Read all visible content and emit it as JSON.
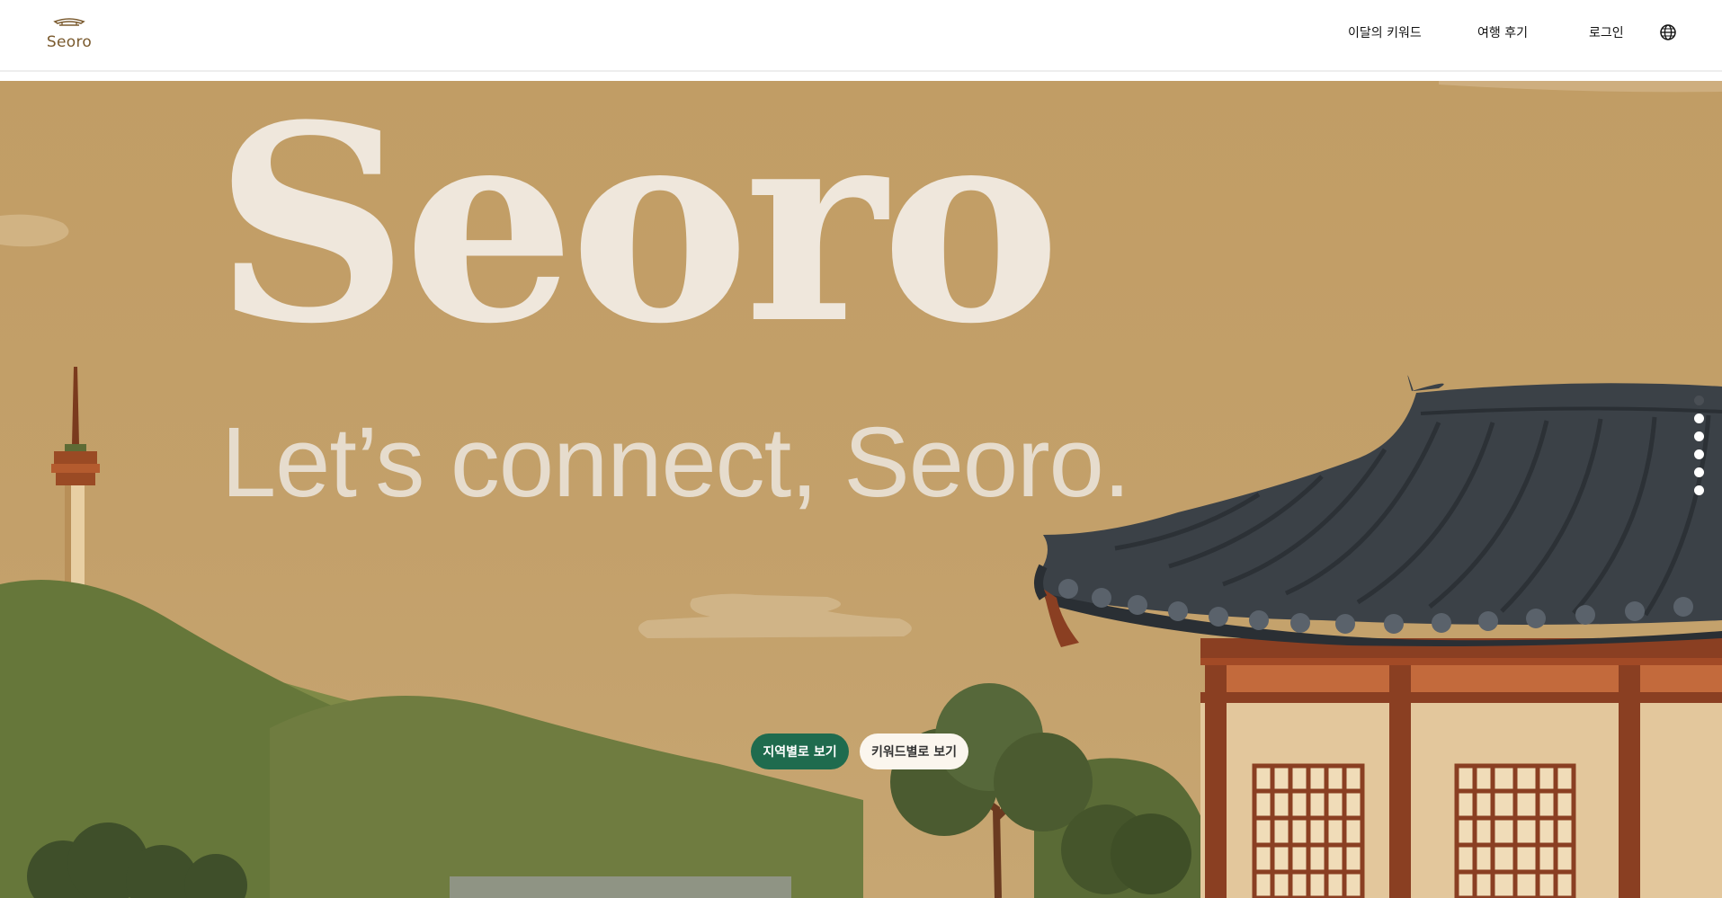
{
  "header": {
    "logo_text": "Seoro",
    "logo_icon": "hanok-roof-icon",
    "nav": {
      "keyword_of_month": "이달의 키워드",
      "travel_reviews": "여행 후기",
      "login": "로그인"
    },
    "language_icon": "globe-icon"
  },
  "hero": {
    "title": "Seoro",
    "subtitle": "Let’s connect, Seoro.",
    "buttons": {
      "by_region": "지역별로 보기",
      "by_keyword": "키워드별로 보기"
    },
    "pagination": {
      "total": 6,
      "active_index": 0
    }
  },
  "colors": {
    "sky": "#c19d65",
    "title_text": "#efe7dc",
    "primary_button": "#1f6b4e",
    "secondary_button": "#fbf6ee",
    "roof": "#3b4147",
    "wood": "#8a3f22",
    "hills": "#6b7a3c"
  }
}
